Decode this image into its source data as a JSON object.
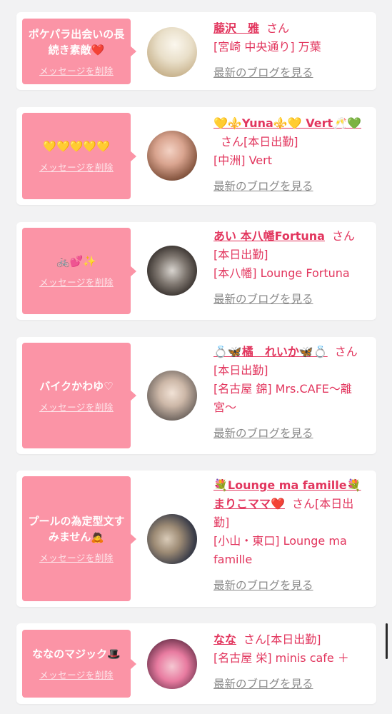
{
  "colors": {
    "accent": "#e2365e",
    "bubble": "#fb94a6",
    "link_gray": "#8a8a8a"
  },
  "cards": [
    {
      "message": "ポケパラ出会いの長続き素敵❤️",
      "delete_label": "メッセージを削除",
      "name": "藤沢　雅",
      "suffix": "さん",
      "status": "",
      "location": "[宮崎 中央通り] 万葉",
      "blog_link": "最新のブログを見る"
    },
    {
      "message": "💛💛💛💛💛",
      "delete_label": "メッセージを削除",
      "name": "💛⚜️Yuna⚜️💛 Vert🥂💚",
      "suffix": "さん",
      "status": "[本日出勤]",
      "location": "[中洲] Vert",
      "blog_link": "最新のブログを見る"
    },
    {
      "message": "🚲💕✨",
      "delete_label": "メッセージを削除",
      "name": "あい 本八幡Fortuna",
      "suffix": "さん",
      "status": "[本日出勤]",
      "location": "[本八幡] Lounge Fortuna",
      "blog_link": "最新のブログを見る"
    },
    {
      "message": "バイクかわゆ♡",
      "delete_label": "メッセージを削除",
      "name": "💍🦋橘　れいか🦋💍",
      "suffix": "さん",
      "status": "[本日出勤]",
      "location": "[名古屋 錦] Mrs.CAFE〜離宮〜",
      "blog_link": "最新のブログを見る"
    },
    {
      "message": "プールの為定型文すみません🙇",
      "delete_label": "メッセージを削除",
      "name": "💐Lounge ma famille💐まりこママ❤️",
      "suffix": "さん",
      "status": "[本日出勤]",
      "location": "[小山・東口] Lounge ma famille",
      "blog_link": "最新のブログを見る"
    },
    {
      "message": "ななのマジック🎩",
      "delete_label": "メッセージを削除",
      "name": "なな",
      "suffix": "さん",
      "status": "[本日出勤]",
      "location": "[名古屋 栄] minis cafe ＋",
      "blog_link": "最新のブログを見る"
    }
  ]
}
